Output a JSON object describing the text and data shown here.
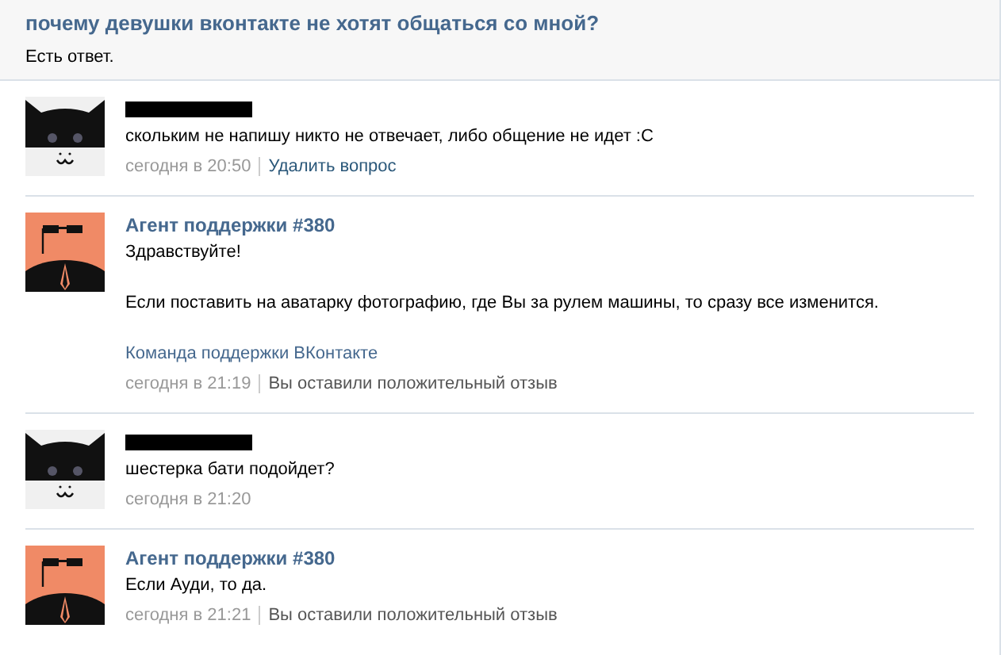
{
  "question": {
    "title": "почему девушки вконтакте не хотят общаться со мной?",
    "status": "Есть ответ."
  },
  "messages": [
    {
      "kind": "user",
      "name_redacted": true,
      "paragraphs": [
        "скольким не напишу никто не отвечает, либо общение не идет :С"
      ],
      "time": "сегодня в 20:50",
      "action": {
        "kind": "link",
        "text": "Удалить вопрос"
      }
    },
    {
      "kind": "agent",
      "author": "Агент поддержки #380",
      "paragraphs": [
        "Здравствуйте!",
        "Если поставить на аватарку фотографию, где Вы за рулем машины, то сразу все изменится."
      ],
      "signature": "Команда поддержки ВКонтакте",
      "time": "сегодня в 21:19",
      "action": {
        "kind": "note",
        "text": "Вы оставили положительный отзыв"
      }
    },
    {
      "kind": "user",
      "name_redacted": true,
      "paragraphs": [
        "шестерка бати подойдет?"
      ],
      "time": "сегодня в 21:20"
    },
    {
      "kind": "agent",
      "author": "Агент поддержки #380",
      "paragraphs": [
        "Если Ауди, то да."
      ],
      "time": "сегодня в 21:21",
      "action": {
        "kind": "note",
        "text": "Вы оставили положительный отзыв"
      }
    }
  ]
}
